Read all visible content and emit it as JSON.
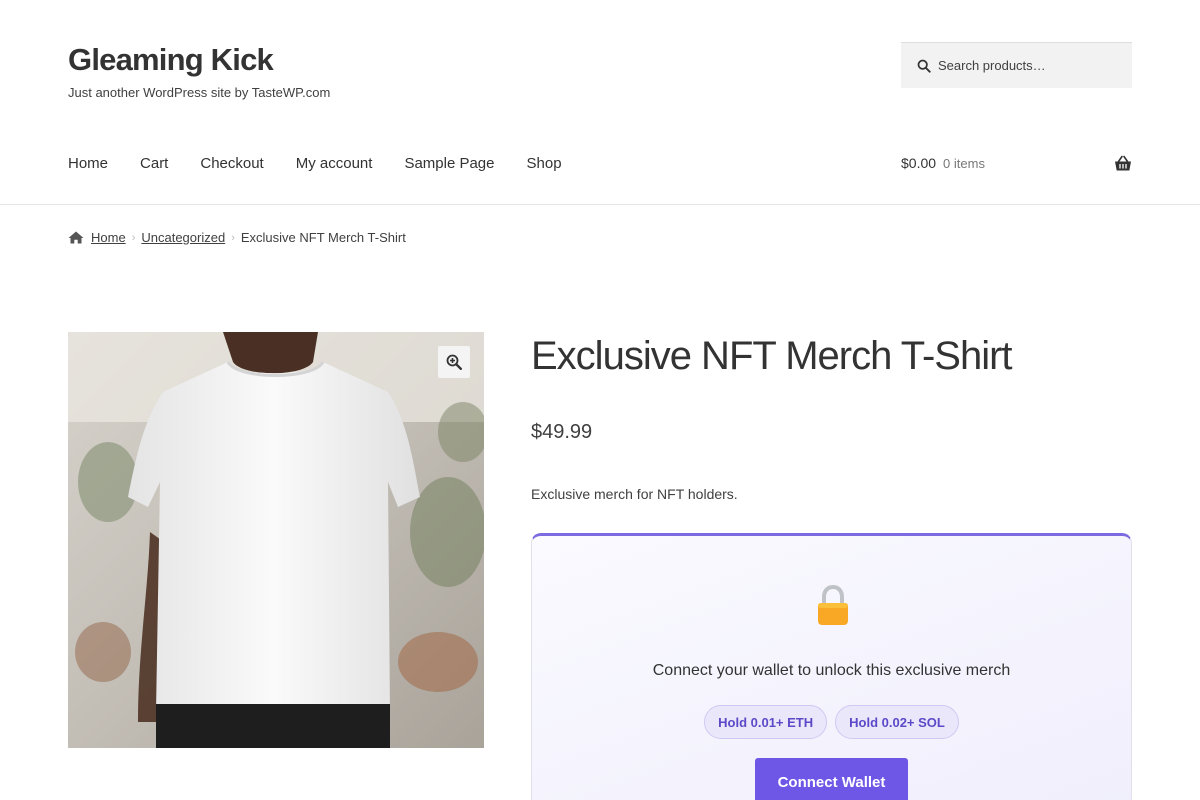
{
  "site": {
    "title": "Gleaming Kick",
    "tagline": "Just another WordPress site by TasteWP.com"
  },
  "search": {
    "placeholder": "Search products…",
    "icon": "search-icon"
  },
  "nav": {
    "items": [
      {
        "label": "Home"
      },
      {
        "label": "Cart"
      },
      {
        "label": "Checkout"
      },
      {
        "label": "My account"
      },
      {
        "label": "Sample Page"
      },
      {
        "label": "Shop"
      }
    ]
  },
  "cart": {
    "amount": "$0.00",
    "count": "0 items",
    "icon": "basket-icon"
  },
  "breadcrumb": {
    "home": "Home",
    "category": "Uncategorized",
    "current": "Exclusive NFT Merch T-Shirt",
    "separator": "›"
  },
  "product": {
    "title": "Exclusive NFT Merch T-Shirt",
    "price": "$49.99",
    "short_description": "Exclusive merch for NFT holders.",
    "image_alt": "white t-shirt on model",
    "zoom_icon": "zoom-in-icon"
  },
  "token_gate": {
    "lock_icon": "lock-icon",
    "message": "Connect your wallet to unlock this exclusive merch",
    "requirements": [
      "Hold 0.01+ ETH",
      "Hold 0.02+ SOL"
    ],
    "button_label": "Connect Wallet"
  },
  "colors": {
    "accent": "#6e57e6",
    "badge_text": "#5b49c7",
    "badge_bg": "#ebe7fb",
    "lock": "#f9a825"
  }
}
